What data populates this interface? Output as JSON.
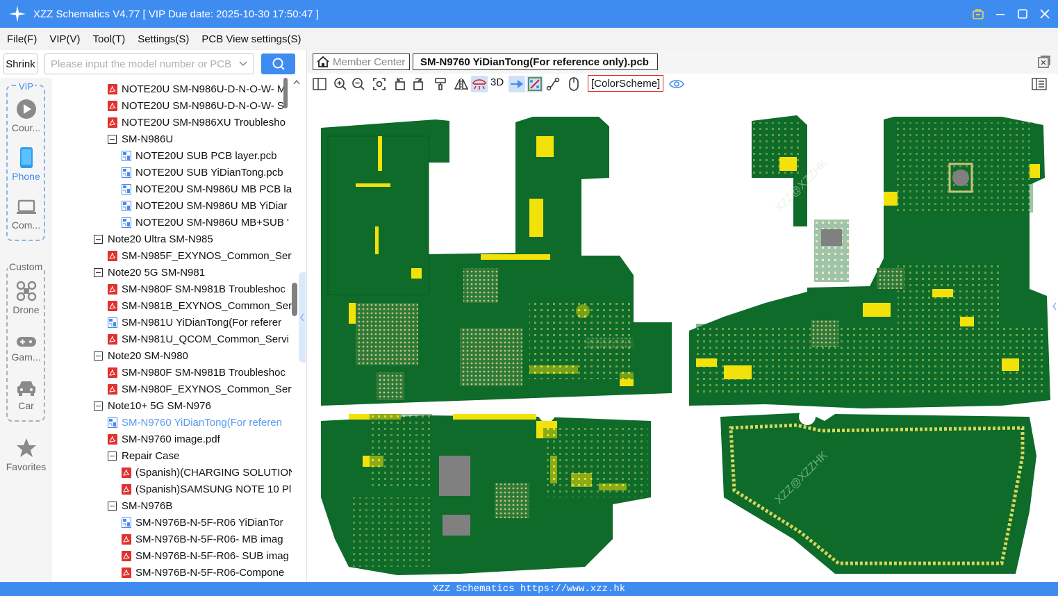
{
  "window": {
    "title": "XZZ Schematics V4.77 [ VIP Due date: 2025-10-30 17:50:47 ]"
  },
  "menu": [
    "File(F)",
    "VIP(V)",
    "Tool(T)",
    "Settings(S)",
    "PCB View settings(S)"
  ],
  "search": {
    "shrink_label": "Shrink",
    "placeholder": "Please input the model number or PCB"
  },
  "leftnav": {
    "vip_label": "VIP",
    "custom_label": "Custom",
    "items": [
      {
        "label": "Cour...",
        "icon": "play-icon"
      },
      {
        "label": "Phone",
        "icon": "phone-icon"
      },
      {
        "label": "Com...",
        "icon": "laptop-icon"
      },
      {
        "label": "Drone",
        "icon": "drone-icon"
      },
      {
        "label": "Gam...",
        "icon": "gamepad-icon"
      },
      {
        "label": "Car",
        "icon": "car-icon"
      },
      {
        "label": "Favorites",
        "icon": "star-icon"
      }
    ]
  },
  "tree": [
    {
      "label": "NOTE20U SM-N986U-D-N-O-W- M",
      "type": "pdf",
      "level": 2
    },
    {
      "label": "NOTE20U SM-N986U-D-N-O-W- S",
      "type": "pdf",
      "level": 2
    },
    {
      "label": "NOTE20U SM-N986XU Troublesho",
      "type": "pdf",
      "level": 2
    },
    {
      "label": "SM-N986U",
      "type": "folder",
      "level": 2
    },
    {
      "label": "NOTE20U  SUB PCB layer.pcb",
      "type": "pcb",
      "level": 3
    },
    {
      "label": "NOTE20U  SUB YiDianTong.pcb",
      "type": "pcb",
      "level": 3
    },
    {
      "label": "NOTE20U SM-N986U MB PCB la",
      "type": "pcb",
      "level": 3
    },
    {
      "label": "NOTE20U SM-N986U MB YiDiar",
      "type": "pcb",
      "level": 3
    },
    {
      "label": "NOTE20U SM-N986U MB+SUB '",
      "type": "pcb",
      "level": 3
    },
    {
      "label": "Note20 Ultra SM-N985",
      "type": "folder",
      "level": 1
    },
    {
      "label": "SM-N985F_EXYNOS_Common_Serv",
      "type": "pdf",
      "level": 2
    },
    {
      "label": "Note20 5G SM-N981",
      "type": "folder",
      "level": 1
    },
    {
      "label": "SM-N980F SM-N981B Troubleshoc",
      "type": "pdf",
      "level": 2
    },
    {
      "label": "SM-N981B_EXYNOS_Common_Serv",
      "type": "pdf",
      "level": 2
    },
    {
      "label": "SM-N981U YiDianTong(For referer",
      "type": "pcb",
      "level": 2
    },
    {
      "label": "SM-N981U_QCOM_Common_Servi",
      "type": "pdf",
      "level": 2
    },
    {
      "label": "Note20 SM-N980",
      "type": "folder",
      "level": 1
    },
    {
      "label": "SM-N980F SM-N981B Troubleshoc",
      "type": "pdf",
      "level": 2
    },
    {
      "label": "SM-N980F_EXYNOS_Common_Serv",
      "type": "pdf",
      "level": 2
    },
    {
      "label": "Note10+ 5G SM-N976",
      "type": "folder",
      "level": 1
    },
    {
      "label": "SM-N9760 YiDianTong(For referen",
      "type": "pcb",
      "level": 2,
      "selected": true
    },
    {
      "label": "SM-N9760 image.pdf",
      "type": "pdf",
      "level": 2
    },
    {
      "label": "Repair Case",
      "type": "folder",
      "level": 2
    },
    {
      "label": "(Spanish)(CHARGING SOLUTION",
      "type": "pdf",
      "level": 3
    },
    {
      "label": "(Spanish)SAMSUNG NOTE 10 Pl",
      "type": "pdf",
      "level": 3
    },
    {
      "label": "SM-N976B",
      "type": "folder",
      "level": 2
    },
    {
      "label": "SM-N976B-N-5F-R06 YiDianTor",
      "type": "pcb",
      "level": 3
    },
    {
      "label": "SM-N976B-N-5F-R06- MB imag",
      "type": "pdf",
      "level": 3
    },
    {
      "label": "SM-N976B-N-5F-R06- SUB imag",
      "type": "pdf",
      "level": 3
    },
    {
      "label": "SM-N976B-N-5F-R06-Compone",
      "type": "pdf",
      "level": 3
    }
  ],
  "tabs": {
    "member_center": "Member Center",
    "file_tab": "SM-N9760 YiDianTong(For reference only).pcb"
  },
  "toolbar": {
    "label_3d": "3D",
    "color_scheme": "[ColorScheme]"
  },
  "canvas": {
    "watermark": "XZZ@XZZHK",
    "board_color": "#0e6b2a",
    "pad_color": "#f2e20a"
  },
  "status": "XZZ Schematics https://www.xzz.hk",
  "colors": {
    "accent": "#3f8cf1"
  }
}
